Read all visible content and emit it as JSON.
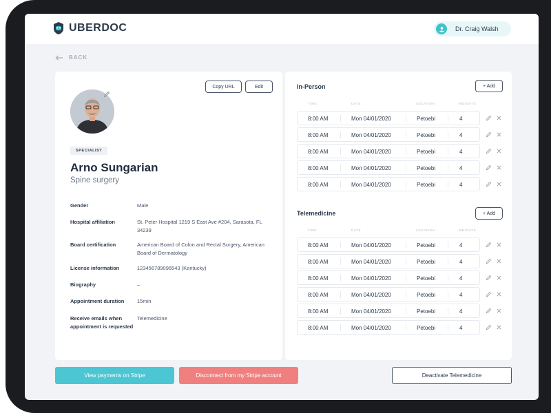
{
  "app": {
    "brand": "UBERDOC",
    "user_name": "Dr. Craig Walsh",
    "back_label": "BACK",
    "accent_color": "#3fc3c9"
  },
  "profile": {
    "copy_url_label": "Copy URL",
    "edit_label": "Edit",
    "badge": "SPECIALIST",
    "name": "Arno Sungarian",
    "specialty": "Spine surgery",
    "fields": [
      {
        "label": "Gender",
        "value": "Male"
      },
      {
        "label": "Hospital affiliation",
        "value": "St. Peter Hospital 1219 S East Ave #204, Sarasota, FL 34239"
      },
      {
        "label": "Board certification",
        "value": "American Board of Colon and Rectal Surgery, American Board of Dermatology"
      },
      {
        "label": "License information",
        "value": "123456789096543 (Kentucky)"
      },
      {
        "label": "Biography",
        "value": "–"
      },
      {
        "label": "Appointment duration",
        "value": "15min"
      },
      {
        "label": "Receive emails when appointment is requested",
        "value": "Telemedicine"
      }
    ]
  },
  "schedule": {
    "in_person": {
      "title": "In-Person",
      "add_label": "+ Add",
      "columns": [
        "TIME",
        "DATE",
        "LOCATION",
        "WEIGHTS"
      ],
      "rows": [
        {
          "time": "8:00 AM",
          "date": "Mon 04/01/2020",
          "location": "Petoebi",
          "weight": "4"
        },
        {
          "time": "8:00 AM",
          "date": "Mon 04/01/2020",
          "location": "Petoebi",
          "weight": "4"
        },
        {
          "time": "8:00 AM",
          "date": "Mon 04/01/2020",
          "location": "Petoebi",
          "weight": "4"
        },
        {
          "time": "8:00 AM",
          "date": "Mon 04/01/2020",
          "location": "Petoebi",
          "weight": "4"
        },
        {
          "time": "8:00 AM",
          "date": "Mon 04/01/2020",
          "location": "Petoebi",
          "weight": "4"
        }
      ]
    },
    "telemedicine": {
      "title": "Telemedicine",
      "add_label": "+ Add",
      "columns": [
        "TIME",
        "DATE",
        "LOCATION",
        "WEIGHTS"
      ],
      "rows": [
        {
          "time": "8:00 AM",
          "date": "Mon 04/01/2020",
          "location": "Petoebi",
          "weight": "4"
        },
        {
          "time": "8:00 AM",
          "date": "Mon 04/01/2020",
          "location": "Petoebi",
          "weight": "4"
        },
        {
          "time": "8:00 AM",
          "date": "Mon 04/01/2020",
          "location": "Petoebi",
          "weight": "4"
        },
        {
          "time": "8:00 AM",
          "date": "Mon 04/01/2020",
          "location": "Petoebi",
          "weight": "4"
        },
        {
          "time": "8:00 AM",
          "date": "Mon 04/01/2020",
          "location": "Petoebi",
          "weight": "4"
        },
        {
          "time": "8:00 AM",
          "date": "Mon 04/01/2020",
          "location": "Petoebi",
          "weight": "4"
        }
      ]
    }
  },
  "footer": {
    "stripe_payments_label": "View payments on Stripe",
    "disconnect_label": "Disconnect from my Stripe account",
    "deactivate_label": "Deactivate Telemedicine",
    "stripe_color": "#4cc6d2",
    "disconnect_color": "#f08080"
  }
}
